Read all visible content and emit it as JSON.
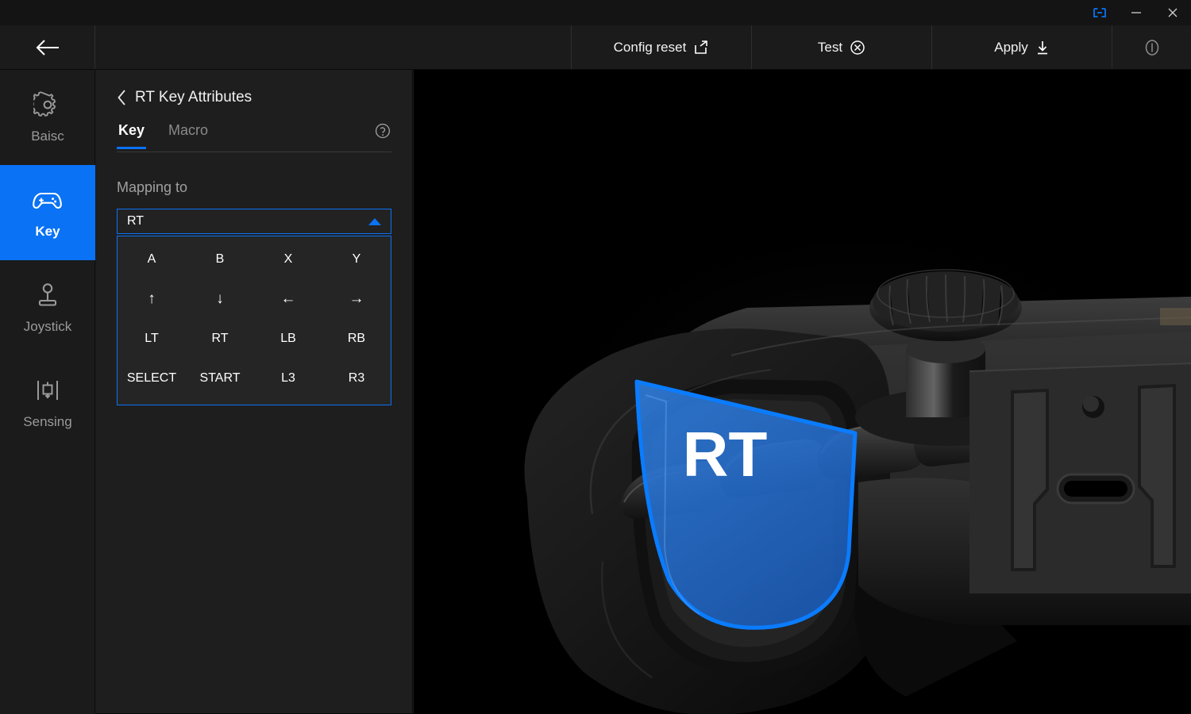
{
  "window": {
    "controls": [
      {
        "name": "link-icon",
        "label": ""
      },
      {
        "name": "minimize-icon",
        "label": ""
      },
      {
        "name": "close-icon",
        "label": ""
      }
    ]
  },
  "toolbar": {
    "back_label": "",
    "config_reset_label": "Config reset",
    "test_label": "Test",
    "apply_label": "Apply",
    "info_label": ""
  },
  "sidebar": {
    "items": [
      {
        "label": "Baisc",
        "icon": "gear-icon",
        "active": false
      },
      {
        "label": "Key",
        "icon": "gamepad-icon",
        "active": true
      },
      {
        "label": "Joystick",
        "icon": "joystick-icon",
        "active": false
      },
      {
        "label": "Sensing",
        "icon": "sensing-icon",
        "active": false
      }
    ]
  },
  "panel": {
    "title": "RT Key Attributes",
    "tabs": [
      {
        "label": "Key",
        "active": true
      },
      {
        "label": "Macro",
        "active": false
      }
    ],
    "mapping_label": "Mapping to",
    "select": {
      "value": "RT",
      "expanded": true,
      "options": [
        "A",
        "B",
        "X",
        "Y",
        "↑",
        "↓",
        "←",
        "→",
        "LT",
        "RT",
        "LB",
        "RB",
        "SELECT",
        "START",
        "L3",
        "R3"
      ]
    }
  },
  "preview": {
    "highlight_label": "RT",
    "highlight_color": "#1f6fd8",
    "highlight_stroke": "#0a7cff"
  },
  "colors": {
    "accent": "#0a72f5",
    "panel_bg": "#1e1e1e",
    "app_bg": "#1b1b1b",
    "preview_bg": "#000000",
    "text": "#f0f0f0",
    "text_muted": "#9a9a9a"
  }
}
